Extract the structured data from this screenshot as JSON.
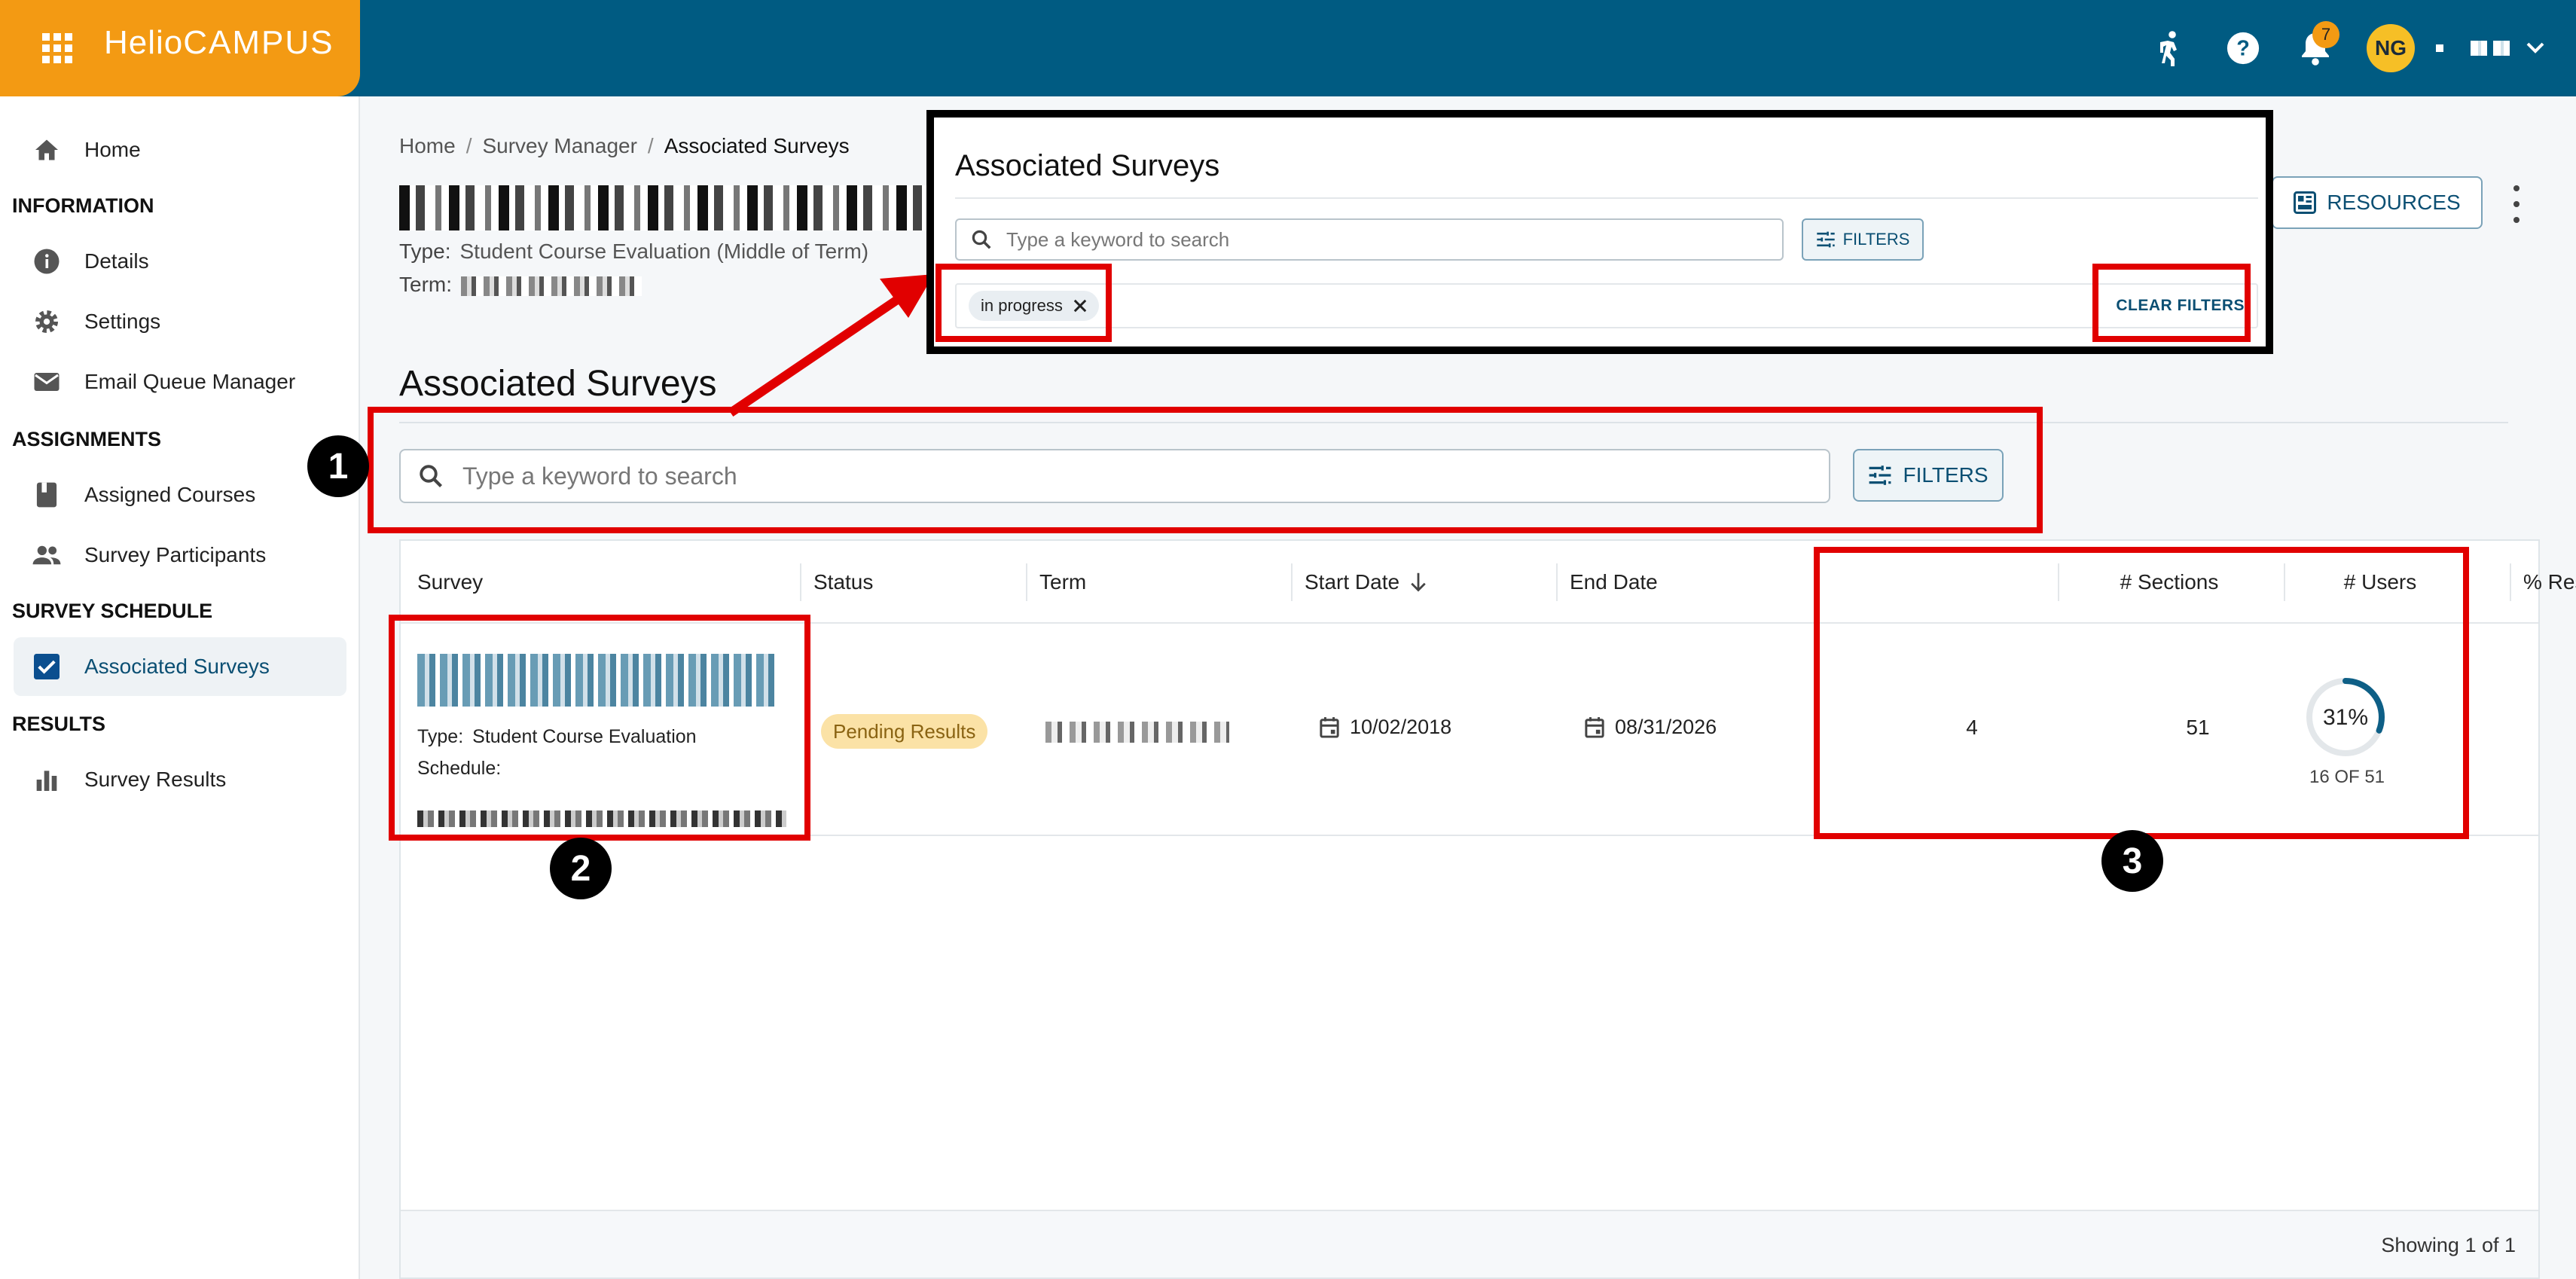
{
  "app": {
    "logo_primary": "Helio",
    "logo_secondary": "CAMPUS",
    "notification_count": "7",
    "user_initials": "NG"
  },
  "sidebar": {
    "home": "Home",
    "sections": [
      {
        "title": "INFORMATION",
        "items": [
          "Details",
          "Settings",
          "Email Queue Manager"
        ]
      },
      {
        "title": "ASSIGNMENTS",
        "items": [
          "Assigned Courses",
          "Survey Participants"
        ]
      },
      {
        "title": "SURVEY SCHEDULE",
        "items": [
          "Associated Surveys"
        ]
      },
      {
        "title": "RESULTS",
        "items": [
          "Survey Results"
        ]
      }
    ]
  },
  "breadcrumb": {
    "home": "Home",
    "survey_manager": "Survey Manager",
    "current": "Associated Surveys"
  },
  "page_meta": {
    "type_label": "Type:",
    "type_value": "Student Course Evaluation (Middle of Term)",
    "term_label": "Term:"
  },
  "actions": {
    "resources": "RESOURCES"
  },
  "section": {
    "title": "Associated Surveys",
    "search_placeholder": "Type a keyword to search",
    "filters": "FILTERS"
  },
  "table": {
    "headers": [
      "Survey",
      "Status",
      "Term",
      "Start Date",
      "End Date",
      "# Sections",
      "# Users",
      "% Response"
    ],
    "rows": [
      {
        "type_label": "Type:",
        "type_value": "Student Course Evaluation",
        "schedule_label": "Schedule:",
        "status": "Pending Results",
        "start_date": "10/02/2018",
        "end_date": "08/31/2026",
        "sections": "4",
        "users": "51",
        "response_pct": "31%",
        "response_fraction": 0.31,
        "response_sub": "16 OF 51"
      }
    ],
    "footer": "Showing 1 of 1"
  },
  "inset": {
    "title": "Associated Surveys",
    "search_placeholder": "Type a keyword to search",
    "filters": "FILTERS",
    "chip": "in progress",
    "clear_filters": "CLEAR FILTERS"
  },
  "callouts": [
    "1",
    "2",
    "3"
  ],
  "colors": {
    "topbar": "#005b82",
    "brand": "#f39a13",
    "annotation_red": "#e10000",
    "link": "#0b4f73"
  }
}
